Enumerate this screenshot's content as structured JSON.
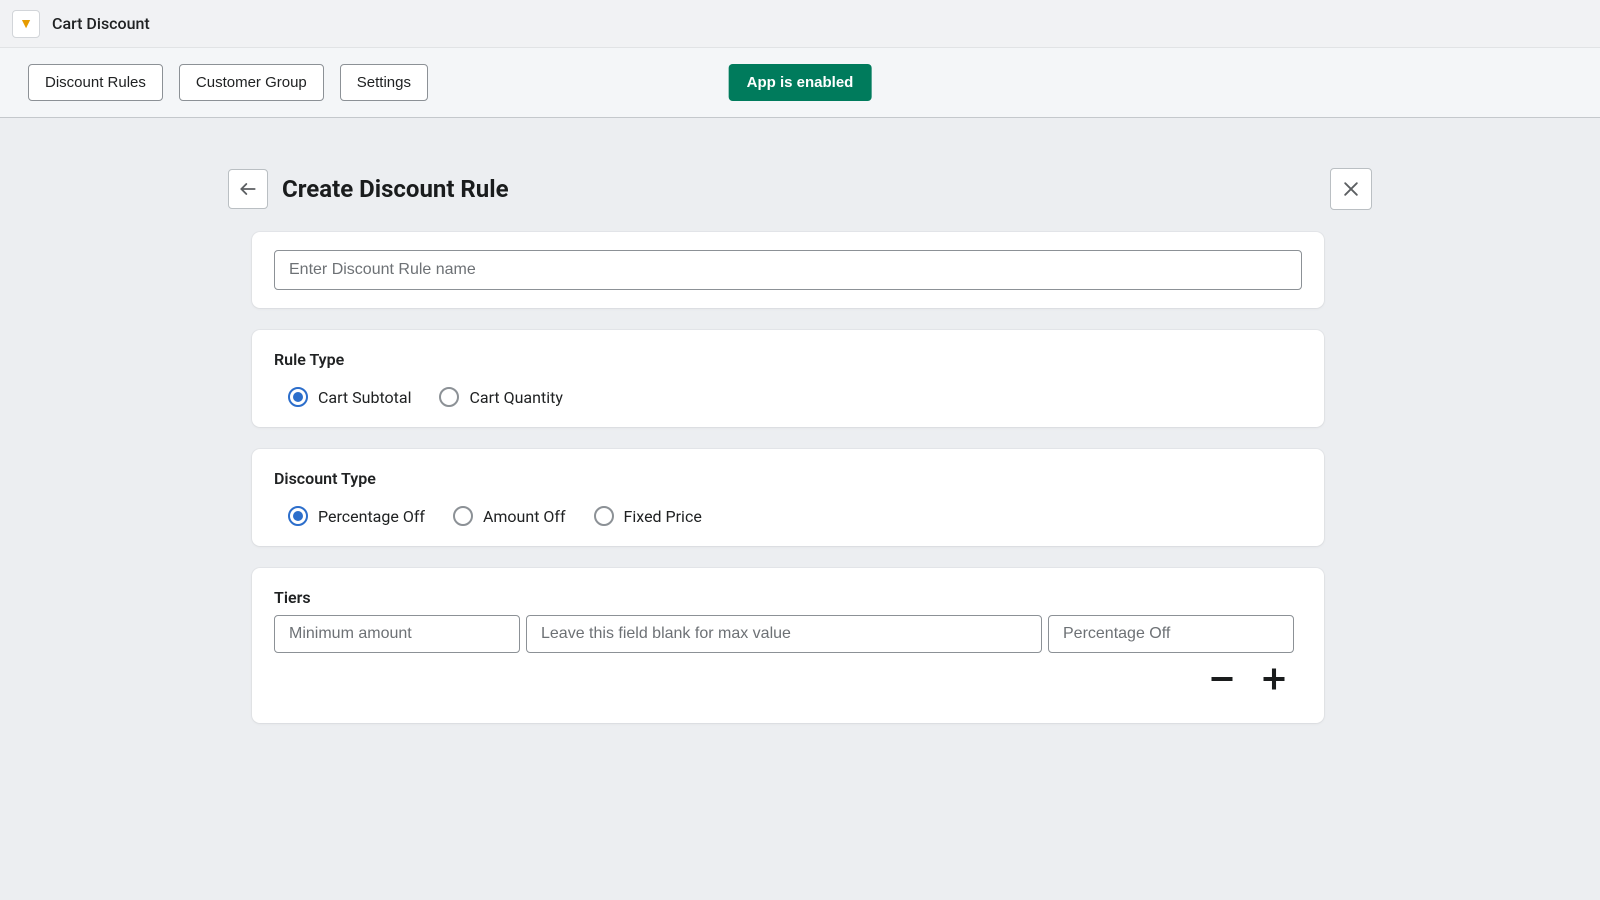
{
  "app": {
    "title": "Cart Discount",
    "icon_glyph": "▼"
  },
  "toolbar": {
    "tabs": [
      {
        "label": "Discount Rules"
      },
      {
        "label": "Customer Group"
      },
      {
        "label": "Settings"
      }
    ],
    "status_label": "App is enabled"
  },
  "page": {
    "title": "Create Discount Rule"
  },
  "form": {
    "name_placeholder": "Enter Discount Rule name",
    "name_value": ""
  },
  "rule_type": {
    "label": "Rule Type",
    "options": [
      {
        "label": "Cart Subtotal",
        "selected": true
      },
      {
        "label": "Cart Quantity",
        "selected": false
      }
    ]
  },
  "discount_type": {
    "label": "Discount Type",
    "options": [
      {
        "label": "Percentage Off",
        "selected": true
      },
      {
        "label": "Amount Off",
        "selected": false
      },
      {
        "label": "Fixed Price",
        "selected": false
      }
    ]
  },
  "tiers": {
    "label": "Tiers",
    "min_placeholder": "Minimum amount",
    "max_placeholder": "Leave this field blank for max value",
    "pct_placeholder": "Percentage Off"
  }
}
